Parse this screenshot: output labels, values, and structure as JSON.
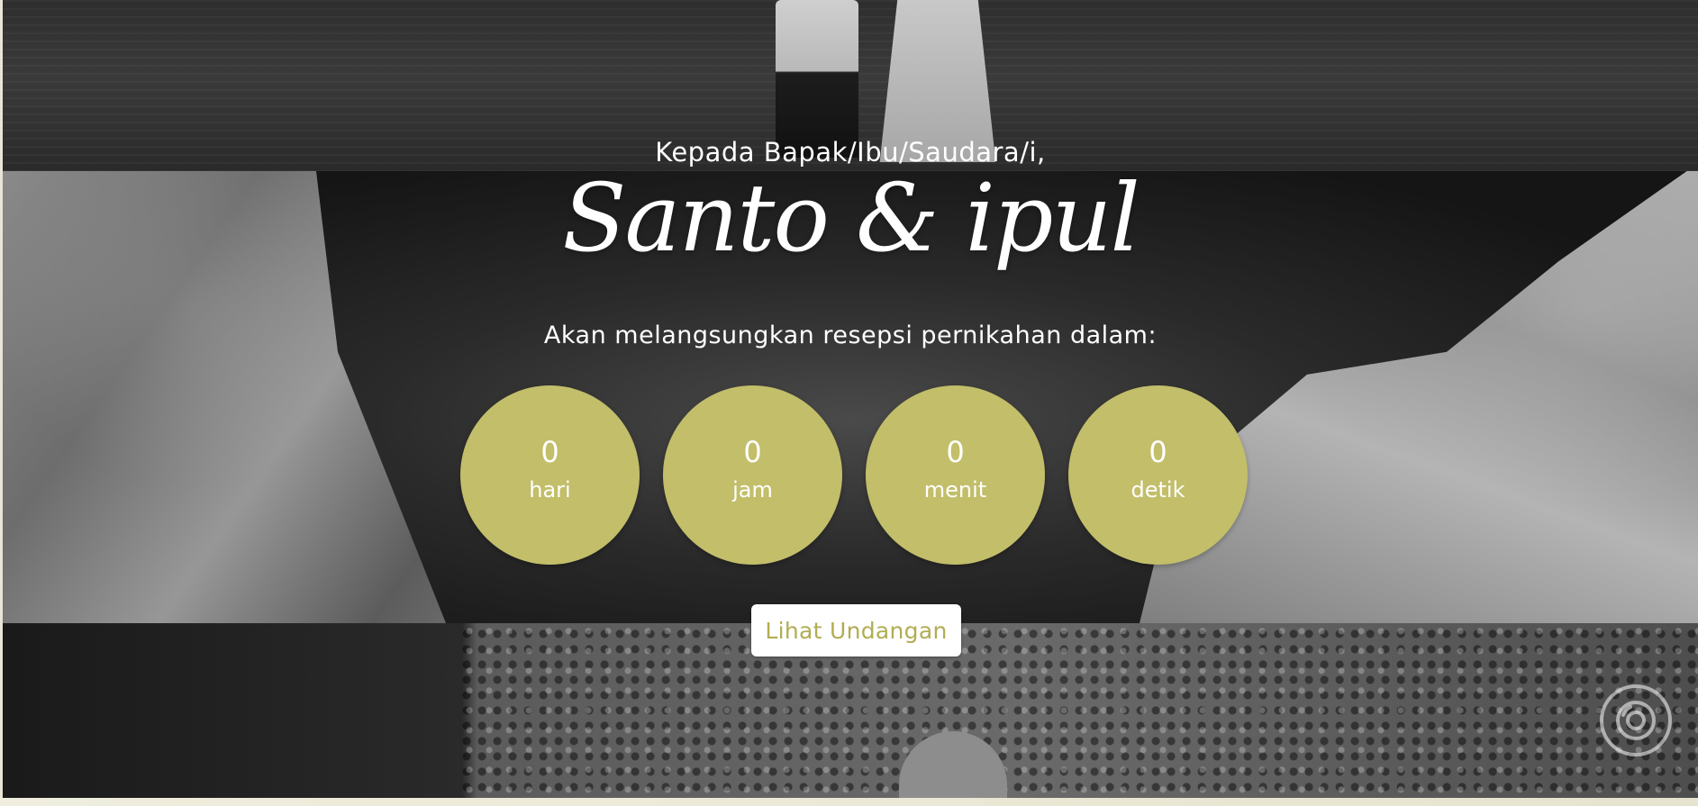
{
  "hero": {
    "greeting": "Kepada Bapak/Ibu/Saudara/i,",
    "couple_names": "Santo & ipul",
    "subtitle": "Akan melangsungkan resepsi pernikahan dalam:"
  },
  "countdown": {
    "days": {
      "value": "0",
      "label": "hari"
    },
    "hours": {
      "value": "0",
      "label": "jam"
    },
    "minutes": {
      "value": "0",
      "label": "menit"
    },
    "seconds": {
      "value": "0",
      "label": "detik"
    }
  },
  "cta": {
    "label": "Lihat Undangan"
  },
  "theme": {
    "accent": "#c2be6a",
    "button_text": "#b1ad52",
    "text": "#ffffff"
  },
  "icons": {
    "music": "music-toggle-icon"
  }
}
